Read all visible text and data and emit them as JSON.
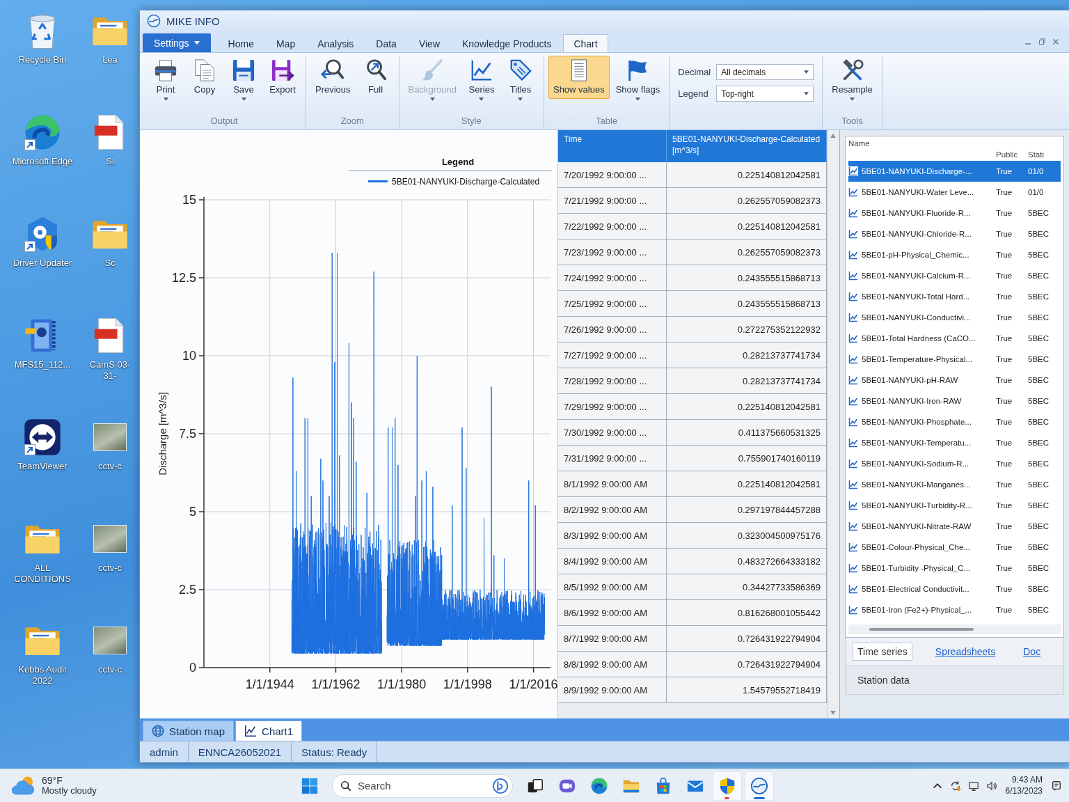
{
  "desktop": {
    "columns": [
      [
        {
          "label": "Recycle Bin",
          "kind": "recycle-bin",
          "shortcut": false
        },
        {
          "label": "Microsoft Edge",
          "kind": "edge",
          "shortcut": true
        },
        {
          "label": "Driver Updater",
          "kind": "driver-updater",
          "shortcut": true
        },
        {
          "label": "MFS15_112...",
          "kind": "installer",
          "shortcut": false
        },
        {
          "label": "TeamViewer",
          "kind": "teamviewer",
          "shortcut": true
        },
        {
          "label": "ALL CONDITIONS",
          "kind": "folder",
          "shortcut": false
        },
        {
          "label": "Kebbs Audit 2022",
          "kind": "folder",
          "shortcut": false
        }
      ],
      [
        {
          "label": "Lea",
          "kind": "folder",
          "shortcut": false
        },
        {
          "label": "Sl",
          "kind": "pdf",
          "shortcut": false
        },
        {
          "label": "Sc",
          "kind": "folder",
          "shortcut": false
        },
        {
          "label": "CamS 03-31-",
          "kind": "pdf",
          "shortcut": false
        },
        {
          "label": "cctv-c",
          "kind": "photo",
          "shortcut": false
        },
        {
          "label": "cctv-c",
          "kind": "photo",
          "shortcut": false
        },
        {
          "label": "cctv-c",
          "kind": "photo",
          "shortcut": false
        }
      ]
    ]
  },
  "window": {
    "title": "MIKE INFO"
  },
  "ribbon": {
    "menu_button": "Settings",
    "tabs": [
      {
        "label": "Home",
        "selected": false
      },
      {
        "label": "Map",
        "selected": false
      },
      {
        "label": "Analysis",
        "selected": false
      },
      {
        "label": "Data",
        "selected": false
      },
      {
        "label": "View",
        "selected": false
      },
      {
        "label": "Knowledge Products",
        "selected": false
      },
      {
        "label": "Chart",
        "selected": true
      }
    ],
    "groups": [
      {
        "kind": "buttons",
        "label": "Output",
        "buttons": [
          {
            "label": "Print",
            "kind": "print",
            "dropdown": true,
            "disabled": false,
            "selected": false
          },
          {
            "label": "Copy",
            "kind": "copy",
            "dropdown": false,
            "disabled": false,
            "selected": false
          },
          {
            "label": "Save",
            "kind": "save",
            "dropdown": true,
            "disabled": false,
            "selected": false
          },
          {
            "label": "Export",
            "kind": "export",
            "dropdown": false,
            "disabled": false,
            "selected": false
          }
        ]
      },
      {
        "kind": "buttons",
        "label": "Zoom",
        "buttons": [
          {
            "label": "Previous",
            "kind": "zoom-previous",
            "dropdown": false,
            "disabled": false,
            "selected": false
          },
          {
            "label": "Full",
            "kind": "zoom-full",
            "dropdown": false,
            "disabled": false,
            "selected": false
          }
        ]
      },
      {
        "kind": "buttons",
        "label": "Style",
        "buttons": [
          {
            "label": "Background",
            "kind": "background",
            "dropdown": true,
            "disabled": true,
            "selected": false
          },
          {
            "label": "Series",
            "kind": "series",
            "dropdown": true,
            "disabled": false,
            "selected": false
          },
          {
            "label": "Titles",
            "kind": "titles",
            "dropdown": true,
            "disabled": false,
            "selected": false
          }
        ]
      },
      {
        "kind": "buttons",
        "label": "Table",
        "buttons": [
          {
            "label": "Show values",
            "kind": "show-values",
            "dropdown": false,
            "disabled": false,
            "selected": true
          },
          {
            "label": "Show flags",
            "kind": "show-flags",
            "dropdown": true,
            "disabled": false,
            "selected": false
          }
        ]
      },
      {
        "kind": "fields",
        "fields": [
          {
            "label": "Decimal",
            "value": "All decimals"
          },
          {
            "label": "Legend",
            "value": "Top-right"
          }
        ]
      },
      {
        "kind": "buttons",
        "label": "Tools",
        "buttons": [
          {
            "label": "Resample",
            "kind": "resample",
            "dropdown": true,
            "disabled": false,
            "selected": false
          }
        ]
      }
    ]
  },
  "chart": {
    "legend_title": "Legend",
    "series_name": "5BE01-NANYUKI-Discharge-Calculated",
    "y_title": "Discharge [m^3/s]",
    "y_ticks": [
      "15",
      "12.5",
      "10",
      "7.5",
      "5",
      "2.5",
      "0"
    ],
    "x_ticks": [
      "1/1/1944",
      "1/1/1962",
      "1/1/1980",
      "1/1/1998",
      "1/1/2016"
    ]
  },
  "table": {
    "columns": [
      "Time",
      "5BE01-NANYUKI-Discharge-Calculated [m^3/s]"
    ],
    "rows": [
      [
        "7/20/1992 9:00:00 ...",
        "0.225140812042581"
      ],
      [
        "7/21/1992 9:00:00 ...",
        "0.262557059082373"
      ],
      [
        "7/22/1992 9:00:00 ...",
        "0.225140812042581"
      ],
      [
        "7/23/1992 9:00:00 ...",
        "0.262557059082373"
      ],
      [
        "7/24/1992 9:00:00 ...",
        "0.243555515868713"
      ],
      [
        "7/25/1992 9:00:00 ...",
        "0.243555515868713"
      ],
      [
        "7/26/1992 9:00:00 ...",
        "0.272275352122932"
      ],
      [
        "7/27/1992 9:00:00 ...",
        "0.28213737741734"
      ],
      [
        "7/28/1992 9:00:00 ...",
        "0.28213737741734"
      ],
      [
        "7/29/1992 9:00:00 ...",
        "0.225140812042581"
      ],
      [
        "7/30/1992 9:00:00 ...",
        "0.411375660531325"
      ],
      [
        "7/31/1992 9:00:00 ...",
        "0.755901740160119"
      ],
      [
        "8/1/1992 9:00:00 AM",
        "0.225140812042581"
      ],
      [
        "8/2/1992 9:00:00 AM",
        "0.297197844457288"
      ],
      [
        "8/3/1992 9:00:00 AM",
        "0.323004500975176"
      ],
      [
        "8/4/1992 9:00:00 AM",
        "0.483272664333182"
      ],
      [
        "8/5/1992 9:00:00 AM",
        "0.34427733586369"
      ],
      [
        "8/6/1992 9:00:00 AM",
        "0.816268001055442"
      ],
      [
        "8/7/1992 9:00:00 AM",
        "0.726431922794904"
      ],
      [
        "8/8/1992 9:00:00 AM",
        "0.726431922794904"
      ],
      [
        "8/9/1992 9:00:00 AM",
        "1.54579552718419"
      ]
    ]
  },
  "series_list": {
    "columns": [
      "Name",
      "Public",
      "Stati"
    ],
    "rows": [
      {
        "name": "5BE01-NANYUKI-Discharge-...",
        "public": "True",
        "station": "01/0",
        "selected": true
      },
      {
        "name": "5BE01-NANYUKI-Water Leve...",
        "public": "True",
        "station": "01/0",
        "selected": false
      },
      {
        "name": "5BE01-NANYUKI-Fluoride-R...",
        "public": "True",
        "station": "5BEC",
        "selected": false
      },
      {
        "name": "5BE01-NANYUKI-Chloride-R...",
        "public": "True",
        "station": "5BEC",
        "selected": false
      },
      {
        "name": "5BE01-pH-Physical_Chemic...",
        "public": "True",
        "station": "5BEC",
        "selected": false
      },
      {
        "name": "5BE01-NANYUKI-Calcium-R...",
        "public": "True",
        "station": "5BEC",
        "selected": false
      },
      {
        "name": "5BE01-NANYUKI-Total Hard...",
        "public": "True",
        "station": "5BEC",
        "selected": false
      },
      {
        "name": "5BE01-NANYUKI-Conductivi...",
        "public": "True",
        "station": "5BEC",
        "selected": false
      },
      {
        "name": "5BE01-Total Hardness (CaCO...",
        "public": "True",
        "station": "5BEC",
        "selected": false
      },
      {
        "name": "5BE01-Temperature-Physical...",
        "public": "True",
        "station": "5BEC",
        "selected": false
      },
      {
        "name": "5BE01-NANYUKI-pH-RAW",
        "public": "True",
        "station": "5BEC",
        "selected": false
      },
      {
        "name": "5BE01-NANYUKI-Iron-RAW",
        "public": "True",
        "station": "5BEC",
        "selected": false
      },
      {
        "name": "5BE01-NANYUKI-Phosphate...",
        "public": "True",
        "station": "5BEC",
        "selected": false
      },
      {
        "name": "5BE01-NANYUKI-Temperatu...",
        "public": "True",
        "station": "5BEC",
        "selected": false
      },
      {
        "name": "5BE01-NANYUKI-Sodium-R...",
        "public": "True",
        "station": "5BEC",
        "selected": false
      },
      {
        "name": "5BE01-NANYUKI-Manganes...",
        "public": "True",
        "station": "5BEC",
        "selected": false
      },
      {
        "name": "5BE01-NANYUKI-Turbidity-R...",
        "public": "True",
        "station": "5BEC",
        "selected": false
      },
      {
        "name": "5BE01-NANYUKI-Nitrate-RAW",
        "public": "True",
        "station": "5BEC",
        "selected": false
      },
      {
        "name": "5BE01-Colour-Physical_Che...",
        "public": "True",
        "station": "5BEC",
        "selected": false
      },
      {
        "name": "5BE01-Turbidity -Physical_C...",
        "public": "True",
        "station": "5BEC",
        "selected": false
      },
      {
        "name": "5BE01-Electrical Conductivit...",
        "public": "True",
        "station": "5BEC",
        "selected": false
      },
      {
        "name": "5BE01-Iron (Fe2+)-Physical_...",
        "public": "True",
        "station": "5BEC",
        "selected": false
      }
    ],
    "nav": [
      [
        {
          "label": "Time series",
          "kind": "tab",
          "selected": true
        },
        {
          "label": "Spreadsheets",
          "kind": "link",
          "selected": false
        },
        {
          "label": "Doc",
          "kind": "link",
          "selected": false
        }
      ],
      [
        {
          "label": "Station data",
          "kind": "tab",
          "selected": false
        }
      ]
    ]
  },
  "document_tabs": [
    {
      "label": "Station map",
      "kind": "map",
      "selected": false
    },
    {
      "label": "Chart1",
      "kind": "chart",
      "selected": true
    }
  ],
  "status_bar": [
    "admin",
    "ENNCA26052021",
    "Status: Ready"
  ],
  "taskbar": {
    "weather": {
      "temperature": "69°F",
      "condition": "Mostly cloudy"
    },
    "search": {
      "placeholder": "Search"
    },
    "apps": [
      {
        "kind": "task-view",
        "running": false,
        "attention": false
      },
      {
        "kind": "chat",
        "running": false,
        "attention": false
      },
      {
        "kind": "edge",
        "running": false,
        "attention": false
      },
      {
        "kind": "explorer",
        "running": false,
        "attention": false
      },
      {
        "kind": "store",
        "running": false,
        "attention": false
      },
      {
        "kind": "mail",
        "running": false,
        "attention": false
      },
      {
        "kind": "security",
        "running": true,
        "attention": true
      },
      {
        "kind": "mike",
        "running": true,
        "attention": false
      }
    ],
    "clock": {
      "time": "9:43 AM",
      "date": "6/13/2023"
    }
  }
}
